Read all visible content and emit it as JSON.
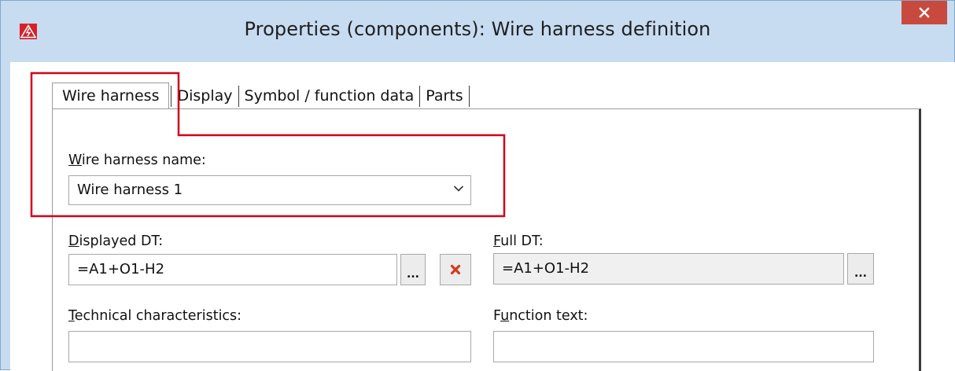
{
  "window": {
    "title": "Properties (components): Wire harness definition"
  },
  "tabs": [
    {
      "label": "Wire harness",
      "active": true
    },
    {
      "label": "Display",
      "active": false
    },
    {
      "label": "Symbol / function data",
      "active": false
    },
    {
      "label": "Parts",
      "active": false
    }
  ],
  "form": {
    "harness_name_label_first": "W",
    "harness_name_label_rest": "ire harness name:",
    "harness_name_value": "Wire harness 1",
    "displayed_dt_label_first": "D",
    "displayed_dt_label_rest": "isplayed DT:",
    "displayed_dt_value": "=A1+O1-H2",
    "full_dt_label_first": "F",
    "full_dt_label_rest": "ull DT:",
    "full_dt_value": "=A1+O1-H2",
    "tech_label_first": "T",
    "tech_label_rest": "echnical characteristics:",
    "tech_value": "",
    "func_label_pre": "F",
    "func_label_ul": "u",
    "func_label_rest": "nction text:",
    "func_value": "",
    "browse_label": "..."
  },
  "colors": {
    "title_bar": "#c7dcf1",
    "close_button": "#c84a3f",
    "highlight": "#d0021b",
    "delete_icon": "#d23a1f"
  },
  "icons": {
    "app": "lightning-warning-icon",
    "close": "close-icon",
    "dropdown": "chevron-down-icon",
    "delete": "delete-x-icon"
  }
}
